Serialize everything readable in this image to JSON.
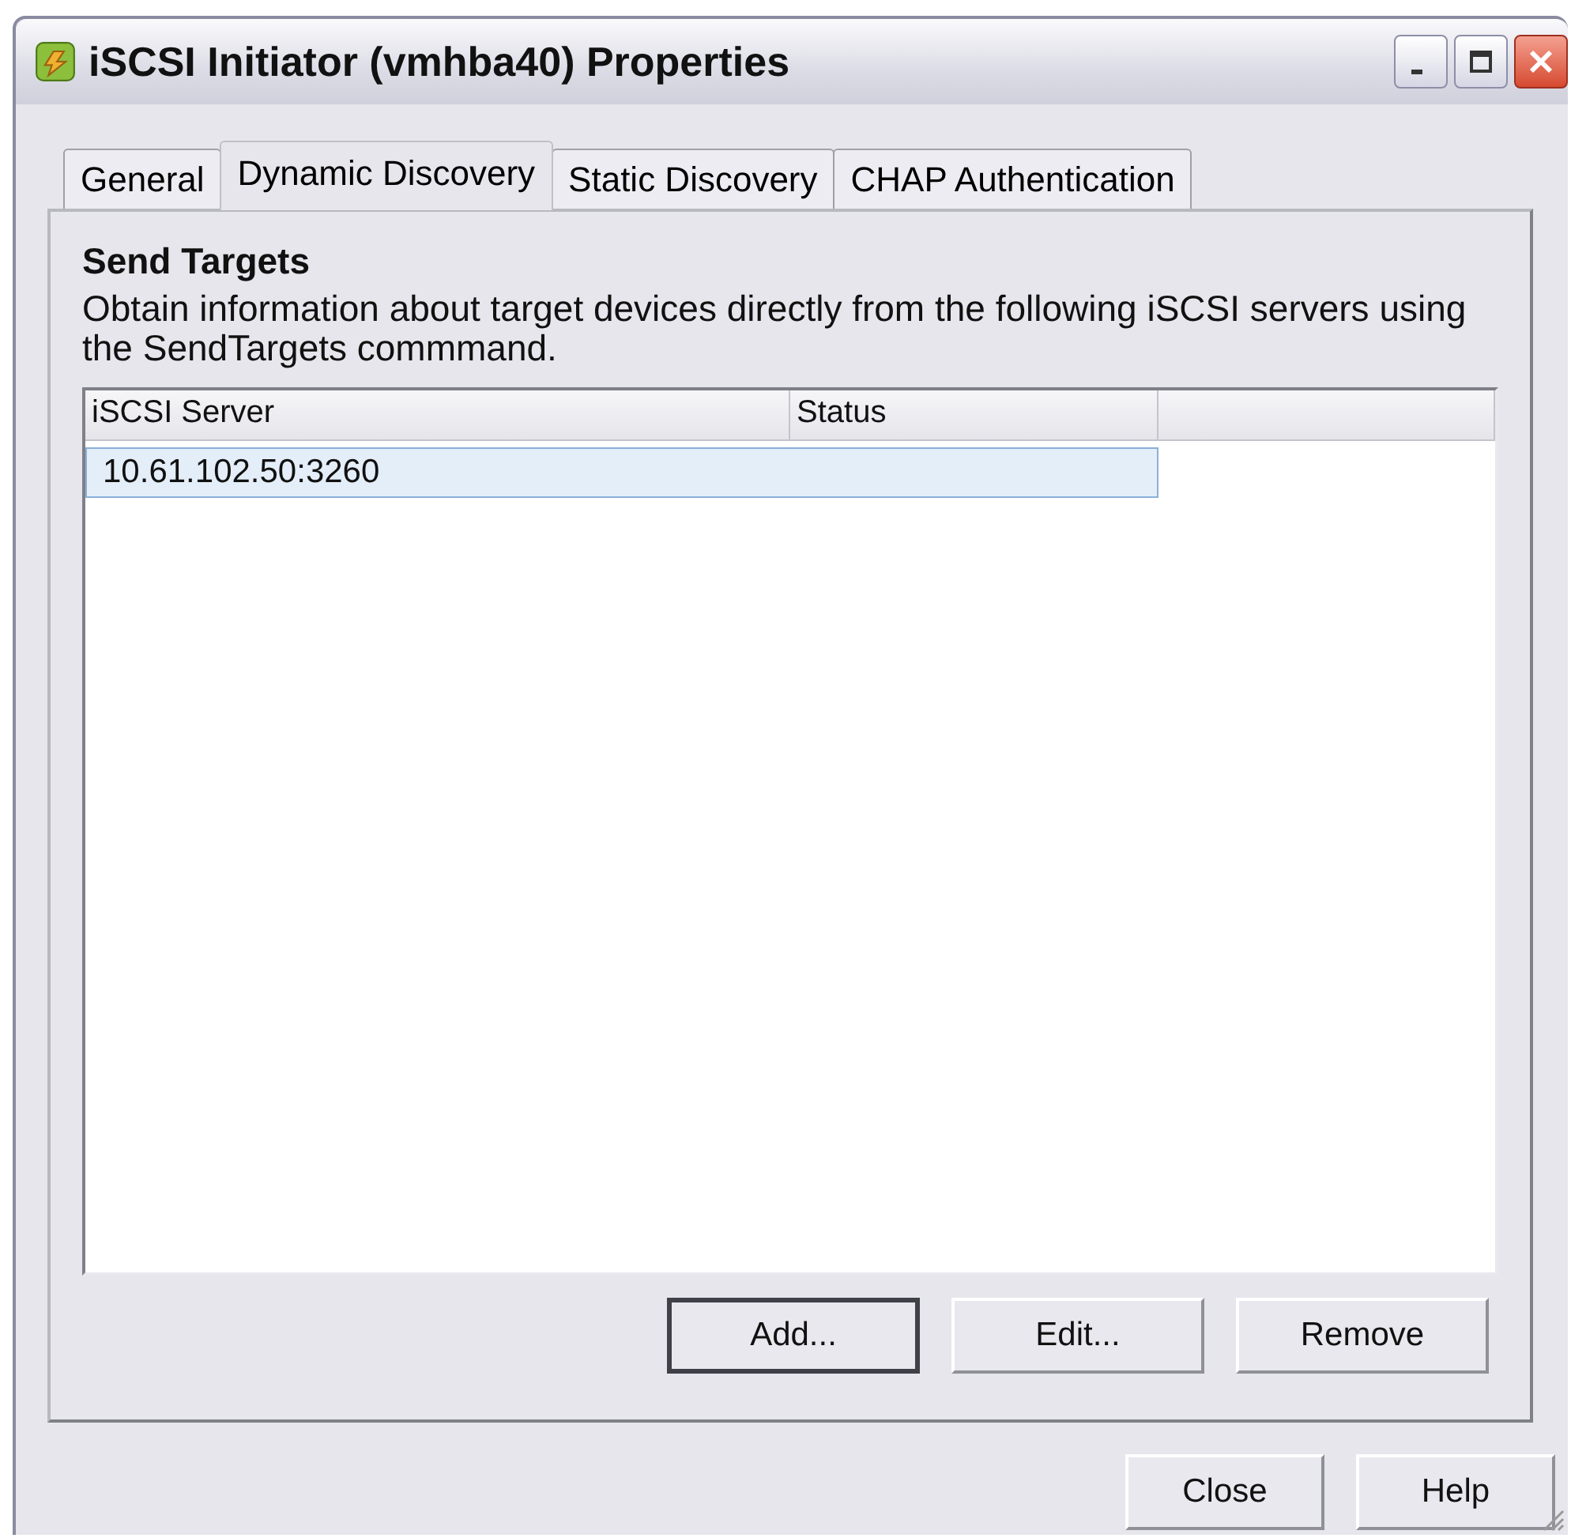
{
  "window": {
    "title": "iSCSI Initiator (vmhba40) Properties"
  },
  "tabs": [
    {
      "label": "General",
      "selected": false
    },
    {
      "label": "Dynamic Discovery",
      "selected": true
    },
    {
      "label": "Static Discovery",
      "selected": false
    },
    {
      "label": "CHAP Authentication",
      "selected": false
    }
  ],
  "section": {
    "heading": "Send Targets",
    "description": "Obtain information about target devices directly from the following iSCSI servers using the SendTargets commmand."
  },
  "table": {
    "columns": [
      "iSCSI Server",
      "Status"
    ],
    "rows": [
      {
        "cells": [
          "10.61.102.50:3260",
          ""
        ],
        "selected": true
      }
    ]
  },
  "panel_buttons": [
    {
      "label": "Add...",
      "default": true
    },
    {
      "label": "Edit...",
      "default": false
    },
    {
      "label": "Remove",
      "default": false
    }
  ],
  "dialog_buttons": [
    {
      "label": "Close",
      "default": false
    },
    {
      "label": "Help",
      "default": false
    }
  ]
}
